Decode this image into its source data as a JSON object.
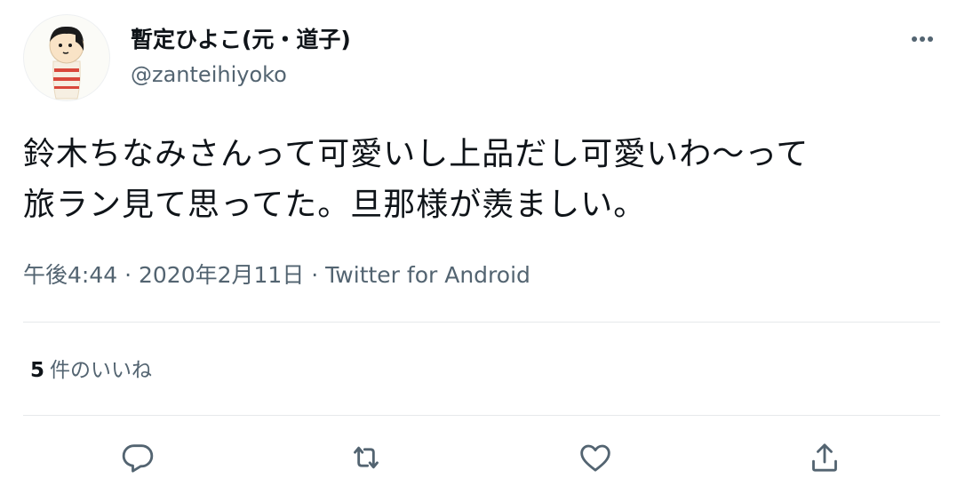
{
  "user": {
    "display_name": "暫定ひよこ(元・道子)",
    "handle": "@zanteihiyoko"
  },
  "tweet": {
    "line1": "鈴木ちなみさんって可愛いし上品だし可愛いわ〜って",
    "line2": "旅ラン見て思ってた。旦那様が羨ましい。"
  },
  "meta": {
    "time": "午後4:44",
    "separator1": " · ",
    "date": "2020年2月11日",
    "separator2": " · ",
    "source": "Twitter for Android"
  },
  "stats": {
    "likes_count": "5",
    "likes_label": "件のいいね"
  },
  "icons": {
    "more": "more-horizontal-icon",
    "reply": "reply-icon",
    "retweet": "retweet-icon",
    "like": "heart-icon",
    "share": "share-icon"
  },
  "colors": {
    "text_primary": "#0f1419",
    "text_secondary": "#536471",
    "divider": "#e6e9eb"
  }
}
